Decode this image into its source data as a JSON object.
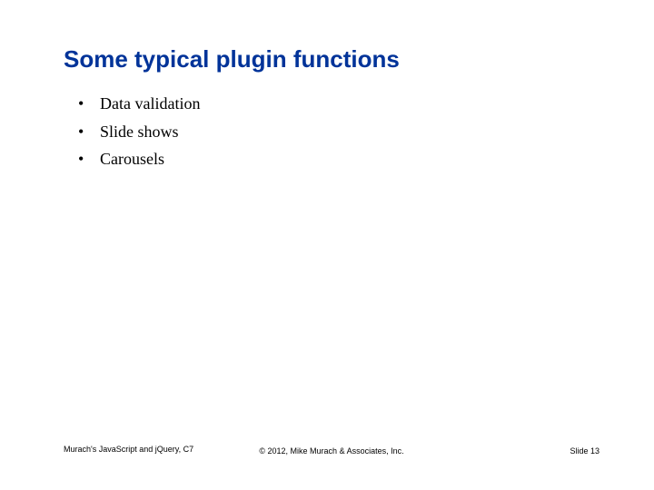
{
  "title": "Some typical plugin functions",
  "bullets": [
    "Data validation",
    "Slide shows",
    "Carousels"
  ],
  "footer": {
    "left": "Murach's JavaScript and jQuery, C7",
    "center": "© 2012, Mike Murach & Associates, Inc.",
    "right": "Slide 13"
  }
}
